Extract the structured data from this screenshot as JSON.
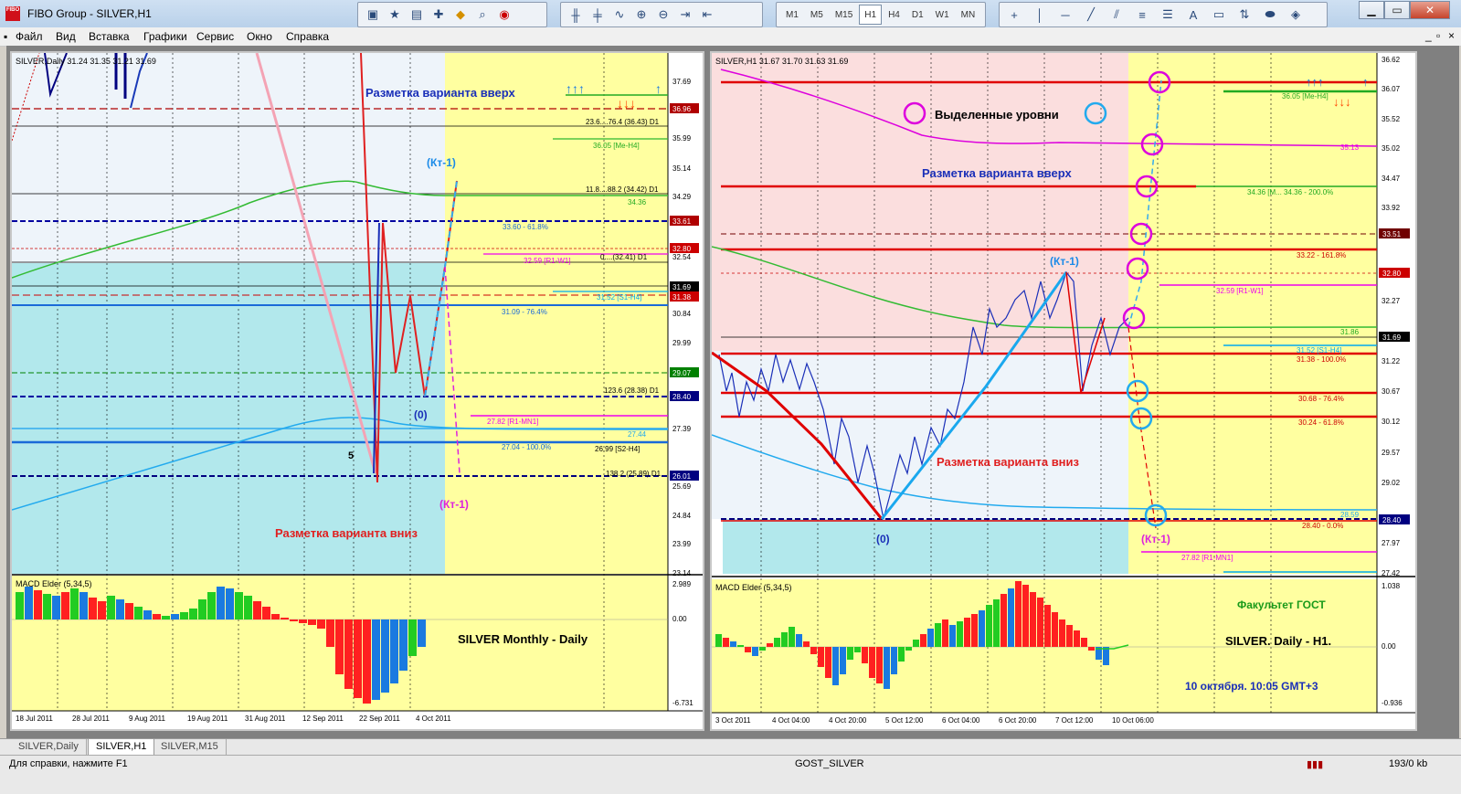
{
  "window": {
    "title": "FIBO Group - SILVER,H1"
  },
  "menu": [
    "Файл",
    "Вид",
    "Вставка",
    "Графики",
    "Сервис",
    "Окно",
    "Справка"
  ],
  "timeframes": [
    "M1",
    "M5",
    "M15",
    "H1",
    "H4",
    "D1",
    "W1",
    "MN"
  ],
  "active_timeframe": "H1",
  "left_chart": {
    "header": "SILVER,Daily  31.24 31.35 31.21 31.69",
    "price_ticks": [
      "37.69",
      "36.84",
      "35.99",
      "35.14",
      "34.29",
      "33.44",
      "32.54",
      "31.69",
      "30.84",
      "29.99",
      "29.14",
      "28.29",
      "27.39",
      "26.54",
      "25.69",
      "24.84",
      "23.99",
      "23.14"
    ],
    "price_markers": [
      {
        "value": "36.96",
        "color": "#b00000"
      },
      {
        "value": "33.61",
        "color": "#b00000"
      },
      {
        "value": "32.80",
        "color": "#cc0000"
      },
      {
        "value": "31.69",
        "color": "#000000"
      },
      {
        "value": "31.38",
        "color": "#cc0000"
      },
      {
        "value": "29.07",
        "color": "#008000"
      },
      {
        "value": "28.40",
        "color": "#000080"
      },
      {
        "value": "26.01",
        "color": "#000080"
      }
    ],
    "level_labels": [
      "23.6....76.4 (36.43) D1",
      "36.05 [Me-H4]",
      "11.8....88.2 (34.42) D1",
      "34.36",
      "33.60 - 61.8%",
      "0....(32.41) D1",
      "32.59 [R1-W1]",
      "31.52 [S1-H4]",
      "31.09 - 76.4%",
      "123.6 (28.38) D1",
      "27.82 [R1-MN1]",
      "27.44",
      "27.04 - 100.0%",
      "26.99 [S2-H4]",
      "138.2 (25.89) D1"
    ],
    "annotations": {
      "up": "Разметка варианта вверх",
      "down": "Разметка варианта вниз",
      "kt1_top": "(Кт-1)",
      "kt1_bottom": "(Кт-1)",
      "zero": "(0)",
      "five": "5"
    },
    "macd_header": "MACD Elder (5,34,5)",
    "macd_ticks": [
      "2.989",
      "0.00",
      "-6.731"
    ],
    "macd_caption": "SILVER  Monthly - Daily",
    "time_labels": [
      "18 Jul 2011",
      "28 Jul 2011",
      "9 Aug 2011",
      "19 Aug 2011",
      "31 Aug 2011",
      "12 Sep 2011",
      "22 Sep 2011",
      "4 Oct 2011"
    ]
  },
  "right_chart": {
    "header": "SILVER,H1  31.67 31.70 31.63 31.69",
    "price_ticks": [
      "36.62",
      "36.07",
      "35.52",
      "35.02",
      "34.47",
      "33.92",
      "33.37",
      "32.82",
      "32.27",
      "31.72",
      "31.22",
      "30.67",
      "30.12",
      "29.57",
      "29.02",
      "28.52",
      "27.97",
      "27.42"
    ],
    "price_markers": [
      {
        "value": "33.51",
        "color": "#700000"
      },
      {
        "value": "32.80",
        "color": "#cc0000"
      },
      {
        "value": "31.69",
        "color": "#000000"
      },
      {
        "value": "28.40",
        "color": "#000080"
      }
    ],
    "level_labels": [
      "36.05 [Me-H4]",
      "35.13",
      "34.36 [M... 34.36 - 200.0%",
      "33.22 - 161.8%",
      "32.59 [R1-W1]",
      "31.86",
      "31.52 [S1-H4]",
      "31.38 - 100.0%",
      "30.68 - 76.4%",
      "30.24 - 61.8%",
      "28.59",
      "28.40 - 0.0%",
      "27.82 [R1-MN1]"
    ],
    "annotations": {
      "levels": "Выделенные уровни",
      "up": "Разметка варианта вверх",
      "down": "Разметка варианта вниз",
      "kt1_top": "(Кт-1)",
      "kt1_bottom": "(Кт-1)",
      "zero": "(0)"
    },
    "macd_header": "MACD Elder (5,34,5)",
    "macd_ticks": [
      "1.038",
      "0.00",
      "-0.936"
    ],
    "captions": [
      "Факультет ГОСТ",
      "SILVER. Daily - H1.",
      "10 октября. 10:05 GMT+3"
    ],
    "time_labels": [
      "3 Oct 2011",
      "4 Oct 04:00",
      "4 Oct 20:00",
      "5 Oct 12:00",
      "6 Oct 04:00",
      "6 Oct 20:00",
      "7 Oct 12:00",
      "10 Oct 06:00"
    ]
  },
  "tabs": [
    "SILVER,Daily",
    "SILVER,H1",
    "SILVER,M15"
  ],
  "active_tab": "SILVER,H1",
  "status": {
    "help": "Для справки, нажмите F1",
    "profile": "GOST_SILVER",
    "traffic": "193/0 kb"
  }
}
